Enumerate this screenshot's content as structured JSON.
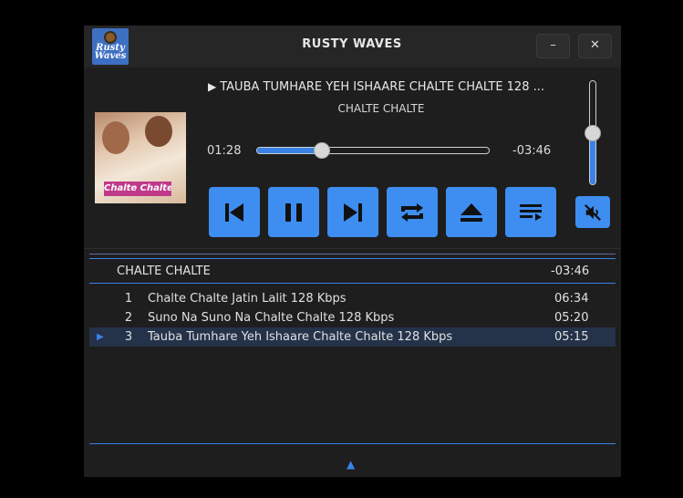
{
  "window": {
    "title": "RUSTY WAVES",
    "logo_text": "Rusty Waves",
    "minimize_label": "–",
    "close_label": "✕"
  },
  "now_playing": {
    "title": "TAUBA TUMHARE YEH ISHAARE CHALTE CHALTE 128 ...",
    "play_mark": "▶",
    "album": "CHALTE CHALTE",
    "cover_label": "Chalte Chalte",
    "elapsed": "01:28",
    "remaining": "-03:46",
    "progress": 0.28
  },
  "controls": [
    {
      "name": "previous-button",
      "icon": "skip-previous-icon"
    },
    {
      "name": "pause-button",
      "icon": "pause-icon"
    },
    {
      "name": "next-button",
      "icon": "skip-next-icon"
    },
    {
      "name": "repeat-button",
      "icon": "repeat-icon"
    },
    {
      "name": "eject-button",
      "icon": "eject-icon"
    },
    {
      "name": "playlist-button",
      "icon": "playlist-icon"
    }
  ],
  "volume": {
    "level": 0.5,
    "muted": true,
    "mute_icon": "volume-muted-icon"
  },
  "playlist": {
    "album": "CHALTE CHALTE",
    "remaining": "-03:46",
    "tracks": [
      {
        "num": "1",
        "title": "Chalte Chalte Jatin Lalit 128 Kbps",
        "duration": "06:34",
        "active": false
      },
      {
        "num": "2",
        "title": "Suno Na Suno Na Chalte Chalte 128 Kbps",
        "duration": "05:20",
        "active": false
      },
      {
        "num": "3",
        "title": "Tauba Tumhare Yeh Ishaare Chalte Chalte 128 Kbps",
        "duration": "05:15",
        "active": true,
        "marker": "▶"
      }
    ],
    "expand_arrow": "▲"
  },
  "colors": {
    "accent": "#3d8ef0",
    "background": "#1e1e1f",
    "titlebar": "#262627",
    "active_row": "#24324a"
  }
}
